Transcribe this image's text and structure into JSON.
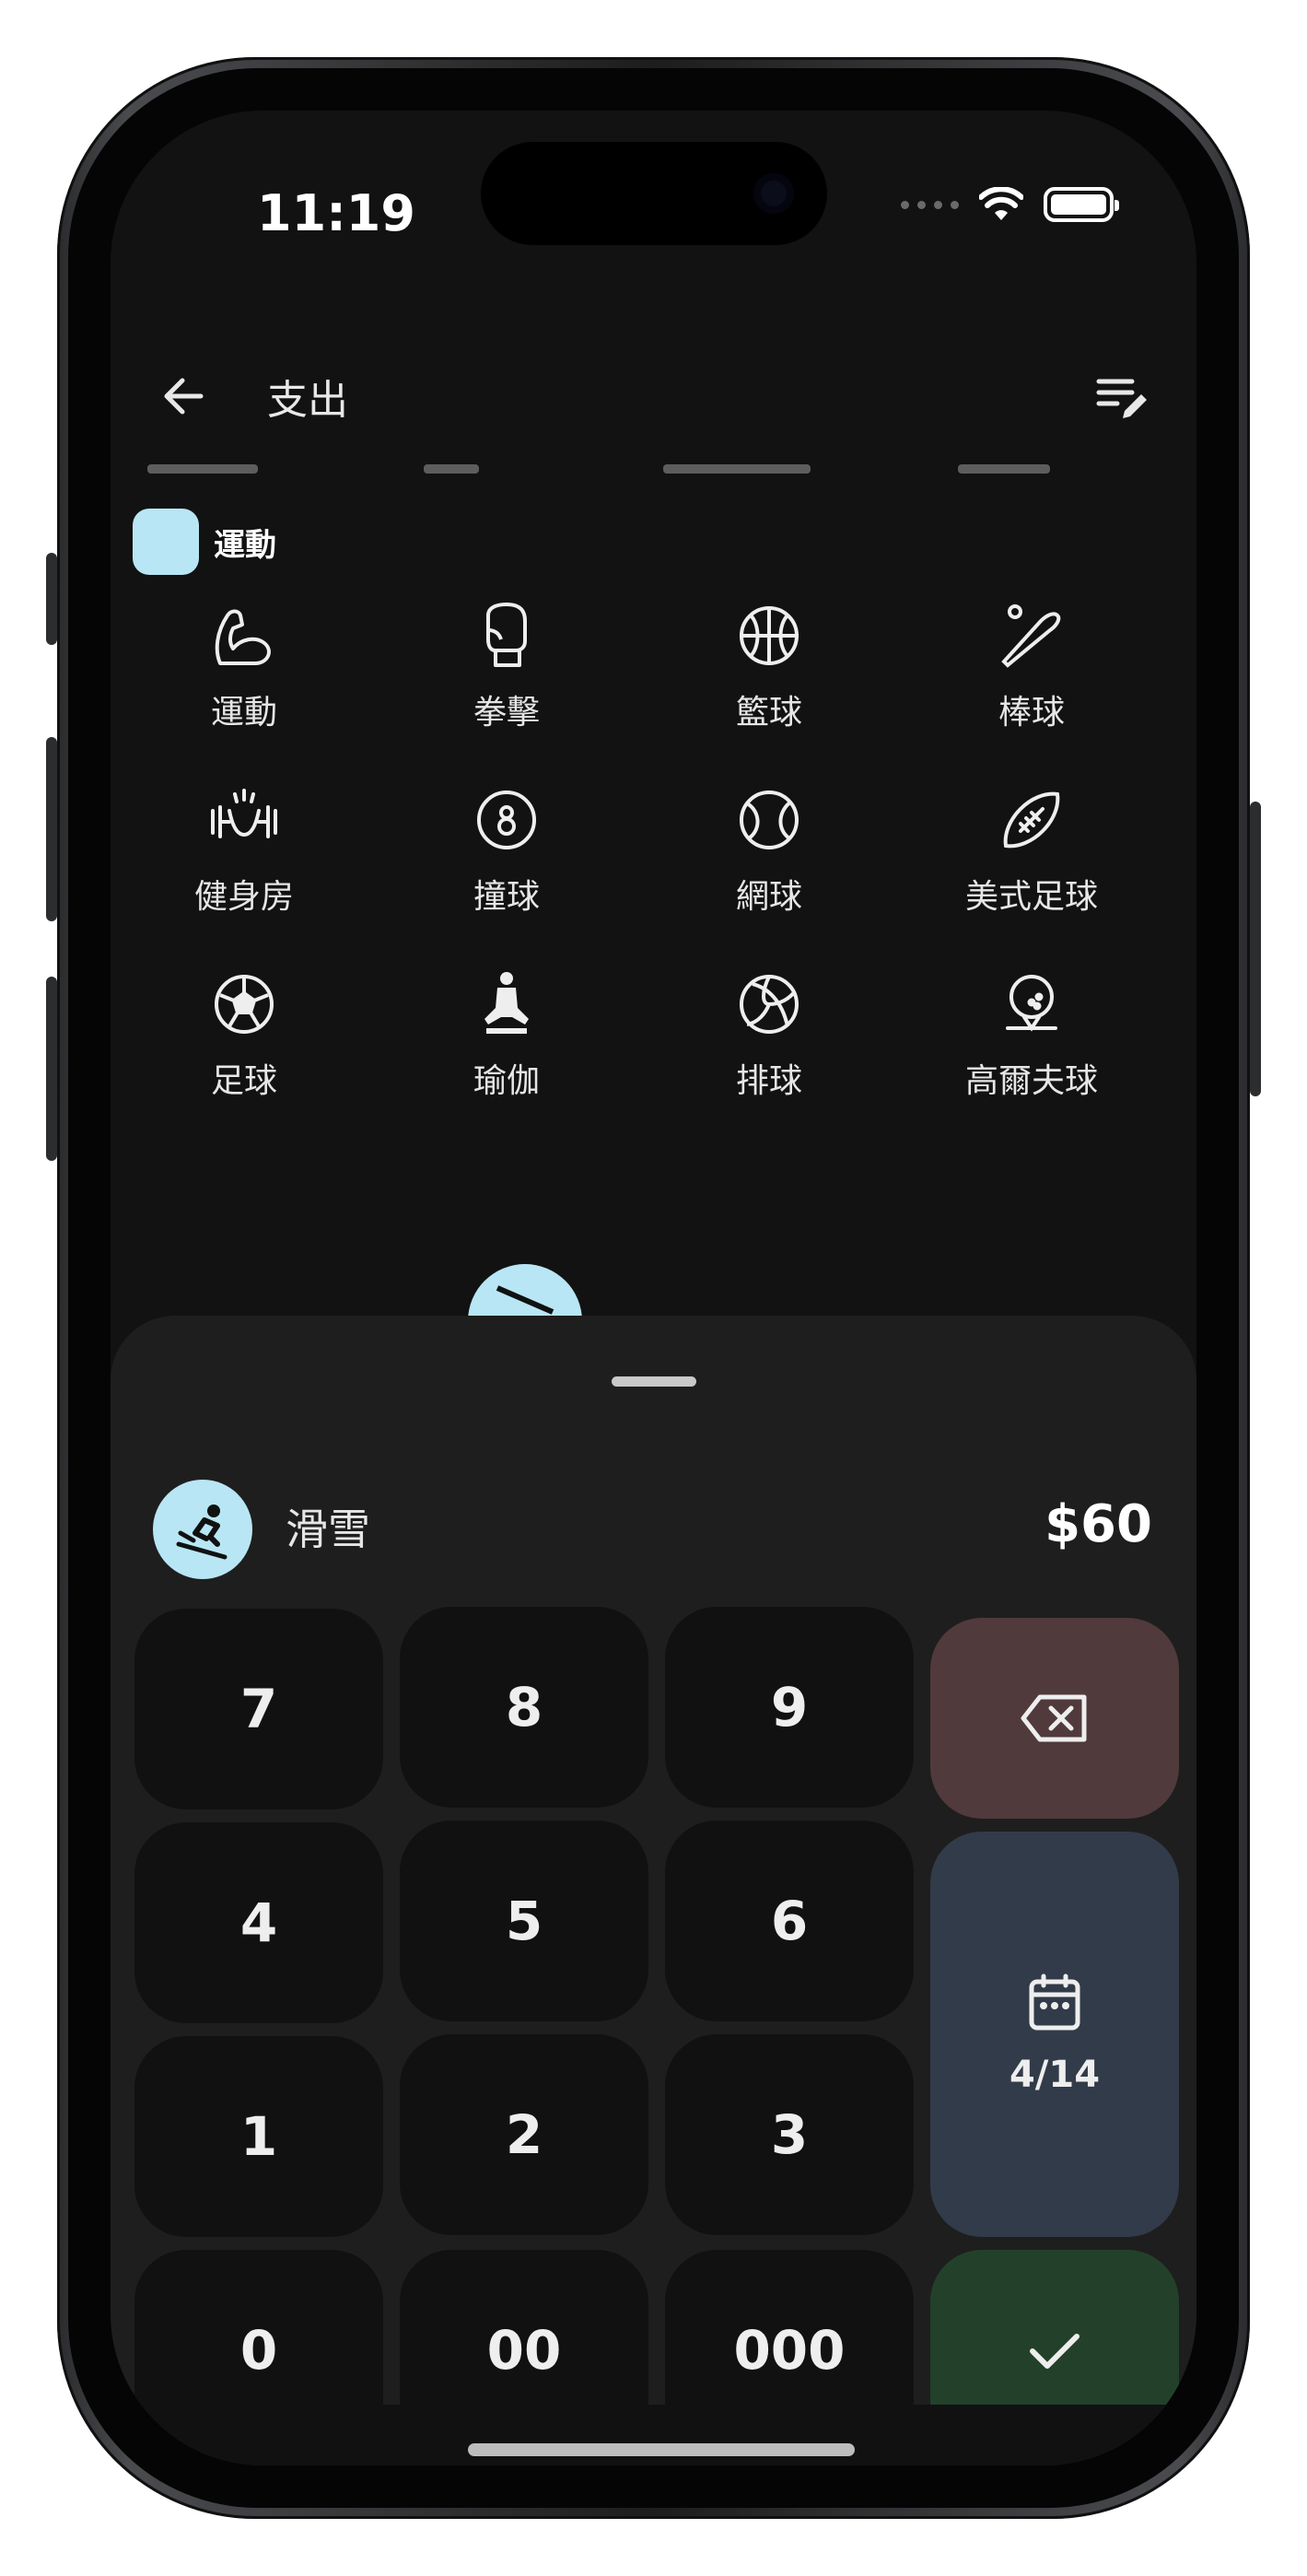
{
  "status_bar": {
    "time": "11:19"
  },
  "header": {
    "title": "支出"
  },
  "category": {
    "title": "運動",
    "color": "#b8e6f5"
  },
  "items": [
    {
      "label": "運動",
      "icon": "flexed-arm-icon"
    },
    {
      "label": "拳擊",
      "icon": "boxing-glove-icon"
    },
    {
      "label": "籃球",
      "icon": "basketball-icon"
    },
    {
      "label": "棒球",
      "icon": "baseball-bat-icon"
    },
    {
      "label": "健身房",
      "icon": "weightlifting-icon"
    },
    {
      "label": "撞球",
      "icon": "billiards-8-ball-icon"
    },
    {
      "label": "網球",
      "icon": "tennis-ball-icon"
    },
    {
      "label": "美式足球",
      "icon": "american-football-icon"
    },
    {
      "label": "足球",
      "icon": "soccer-ball-icon"
    },
    {
      "label": "瑜伽",
      "icon": "yoga-icon"
    },
    {
      "label": "排球",
      "icon": "volleyball-icon"
    },
    {
      "label": "高爾夫球",
      "icon": "golf-ball-icon"
    }
  ],
  "selected": {
    "name": "滑雪",
    "icon": "skiing-icon",
    "amount": "$60"
  },
  "keypad": {
    "k7": "7",
    "k8": "8",
    "k9": "9",
    "k4": "4",
    "k5": "5",
    "k6": "6",
    "k1": "1",
    "k2": "2",
    "k3": "3",
    "k0": "0",
    "k00": "00",
    "k000": "000",
    "date": "4/14"
  }
}
